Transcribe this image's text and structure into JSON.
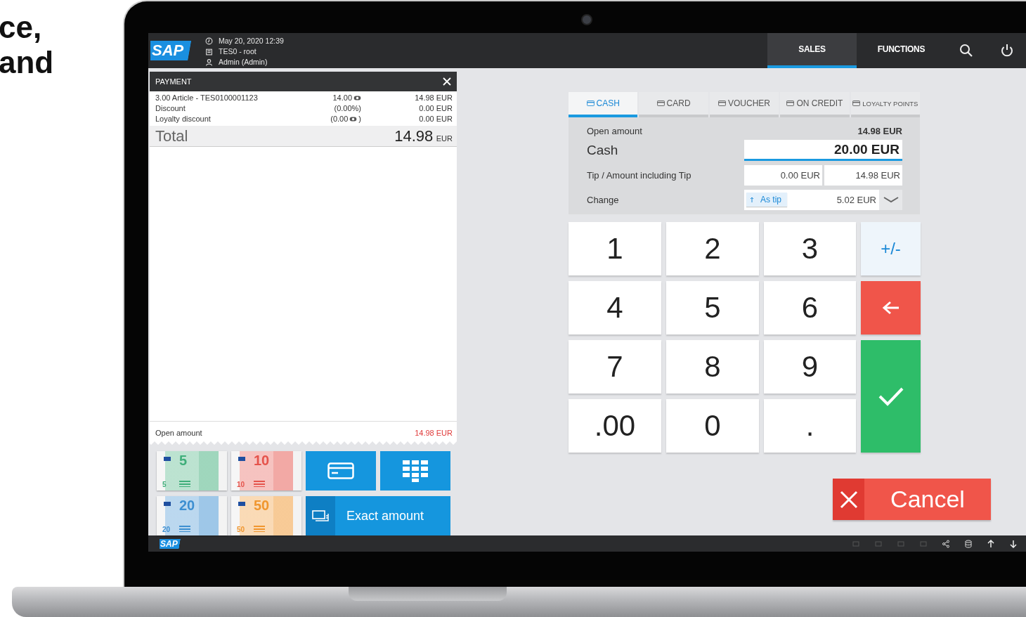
{
  "caption_lines": [
    "ce,",
    "and"
  ],
  "header": {
    "logo": "SAP",
    "datetime": "May 20, 2020 12:39",
    "store": "TES0 - root",
    "user": "Admin (Admin)",
    "nav": [
      {
        "label": "SALES",
        "selected": true
      },
      {
        "label": "FUNCTIONS",
        "selected": false
      }
    ]
  },
  "receipt": {
    "title": "PAYMENT",
    "lines": [
      {
        "description": "3.00 Article - TES0100001123",
        "quantity": "14.00",
        "amount": "14.98 EUR",
        "points": true
      },
      {
        "description": "Discount",
        "quantity": "(0.00%)",
        "amount": "0.00 EUR",
        "points": false
      },
      {
        "description": "Loyalty discount",
        "quantity": "(0.00",
        "quantity_close": ")",
        "amount": "0.00 EUR",
        "points": true
      }
    ],
    "total": {
      "label": "Total",
      "value": "14.98",
      "currency": "EUR"
    },
    "open_amount": {
      "label": "Open amount",
      "value": "14.98 EUR"
    }
  },
  "banknotes": [
    {
      "big": "5",
      "small": "5",
      "color": "#3fae7a"
    },
    {
      "big": "10",
      "small": "10",
      "color": "#e5534b"
    },
    {
      "big": "20",
      "small": "20",
      "color": "#3d8fd1"
    },
    {
      "big": "50",
      "small": "50",
      "color": "#f0962e"
    }
  ],
  "exact_amount": "Exact amount",
  "payment_tabs": [
    {
      "label": "CASH",
      "selected": true
    },
    {
      "label": "CARD",
      "selected": false
    },
    {
      "label": "VOUCHER",
      "selected": false
    },
    {
      "label": "ON CREDIT",
      "selected": false
    },
    {
      "label": "LOYALTY POINTS",
      "selected": false
    }
  ],
  "form": {
    "open_amount": {
      "label": "Open amount",
      "value": "14.98 EUR"
    },
    "cash": {
      "label": "Cash",
      "value": "20.00 EUR"
    },
    "tip": {
      "label": "Tip / Amount including Tip",
      "tip": "0.00 EUR",
      "total": "14.98 EUR"
    },
    "change": {
      "label": "Change",
      "button": "As tip",
      "value": "5.02 EUR"
    }
  },
  "keypad": [
    {
      "kind": "digit",
      "label": "1"
    },
    {
      "kind": "digit",
      "label": "2"
    },
    {
      "kind": "digit",
      "label": "3"
    },
    {
      "kind": "sign",
      "label": "+/-"
    },
    {
      "kind": "digit",
      "label": "4"
    },
    {
      "kind": "digit",
      "label": "5"
    },
    {
      "kind": "digit",
      "label": "6"
    },
    {
      "kind": "backspace"
    },
    {
      "kind": "digit",
      "label": "7"
    },
    {
      "kind": "digit",
      "label": "8"
    },
    {
      "kind": "digit",
      "label": "9"
    },
    {
      "kind": "confirm"
    },
    {
      "kind": "digit",
      "label": ".00"
    },
    {
      "kind": "digit",
      "label": "0"
    },
    {
      "kind": "digit",
      "label": "."
    }
  ],
  "cancel": "Cancel",
  "footer": {
    "logo": "SAP"
  }
}
